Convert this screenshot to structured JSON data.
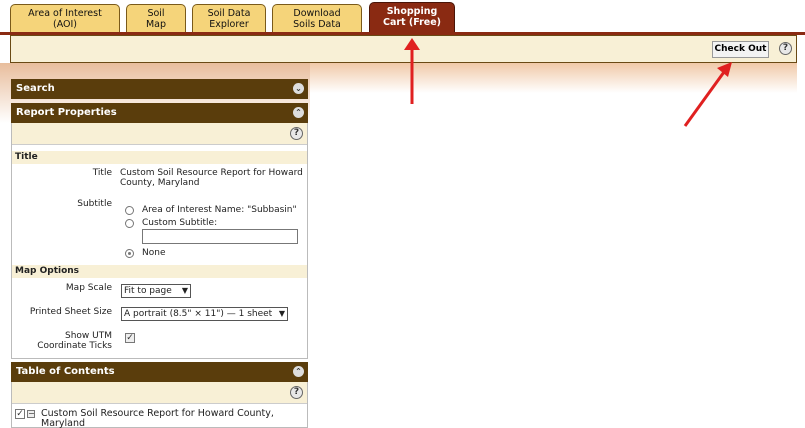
{
  "tabs": [
    {
      "label_l1": "Area of Interest",
      "label_l2": "(AOI)"
    },
    {
      "label_l1": "Soil",
      "label_l2": "Map"
    },
    {
      "label_l1": "Soil Data",
      "label_l2": "Explorer"
    },
    {
      "label_l1": "Download",
      "label_l2": "Soils Data"
    },
    {
      "label_l1": "Shopping",
      "label_l2": "Cart (Free)"
    }
  ],
  "cart": {
    "checkout_label": "Check Out",
    "help": "?"
  },
  "search": {
    "title": "Search"
  },
  "report": {
    "title": "Report Properties",
    "help": "?",
    "title_section": "Title",
    "title_label": "Title",
    "title_value_l1": "Custom Soil Resource Report for Howard",
    "title_value_l2": "County, Maryland",
    "subtitle_label": "Subtitle",
    "subtitle_options": [
      "Area of Interest Name: \"Subbasin\"",
      "Custom Subtitle:",
      "None"
    ],
    "map_section": "Map Options",
    "map_scale_label": "Map Scale",
    "map_scale_value": "Fit to page",
    "sheet_size_label": "Printed Sheet Size",
    "sheet_size_value": "A portrait (8.5\" × 11\") — 1 sheet",
    "utm_label_l1": "Show UTM",
    "utm_label_l2": "Coordinate Ticks"
  },
  "toc": {
    "title": "Table of Contents",
    "help": "?",
    "item_l1": "Custom Soil Resource Report for Howard County,",
    "item_l2": "Maryland"
  },
  "colors": {
    "active_tab": "#8a2a12",
    "tab": "#f5d47a",
    "panel_header": "#5a3d0c",
    "arrow": "#e02020"
  }
}
